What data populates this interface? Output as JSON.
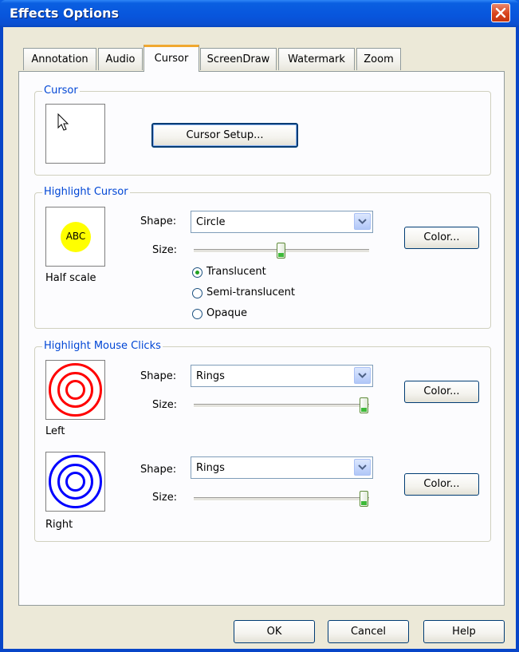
{
  "window": {
    "title": "Effects Options"
  },
  "tabs": [
    {
      "label": "Annotation"
    },
    {
      "label": "Audio"
    },
    {
      "label": "Cursor",
      "active": true
    },
    {
      "label": "ScreenDraw"
    },
    {
      "label": "Watermark"
    },
    {
      "label": "Zoom"
    }
  ],
  "cursor_group": {
    "legend": "Cursor",
    "preview_icon": "arrow-cursor-icon",
    "setup_button": "Cursor Setup..."
  },
  "highlight_cursor": {
    "legend": "Highlight Cursor",
    "preview_text": "ABC",
    "preview_caption": "Half scale",
    "preview_color": "#ffff00",
    "shape_label": "Shape:",
    "shape_value": "Circle",
    "size_label": "Size:",
    "size_value": 0.5,
    "color_button": "Color...",
    "opacity_options": [
      {
        "label": "Translucent",
        "selected": true
      },
      {
        "label": "Semi-translucent",
        "selected": false
      },
      {
        "label": "Opaque",
        "selected": false
      }
    ]
  },
  "highlight_clicks": {
    "legend": "Highlight Mouse Clicks",
    "left": {
      "caption": "Left",
      "ring_color": "#ff0000",
      "shape_label": "Shape:",
      "shape_value": "Rings",
      "size_label": "Size:",
      "size_value": 1.0,
      "color_button": "Color..."
    },
    "right": {
      "caption": "Right",
      "ring_color": "#0000ff",
      "shape_label": "Shape:",
      "shape_value": "Rings",
      "size_label": "Size:",
      "size_value": 1.0,
      "color_button": "Color..."
    }
  },
  "footer": {
    "ok": "OK",
    "cancel": "Cancel",
    "help": "Help"
  }
}
